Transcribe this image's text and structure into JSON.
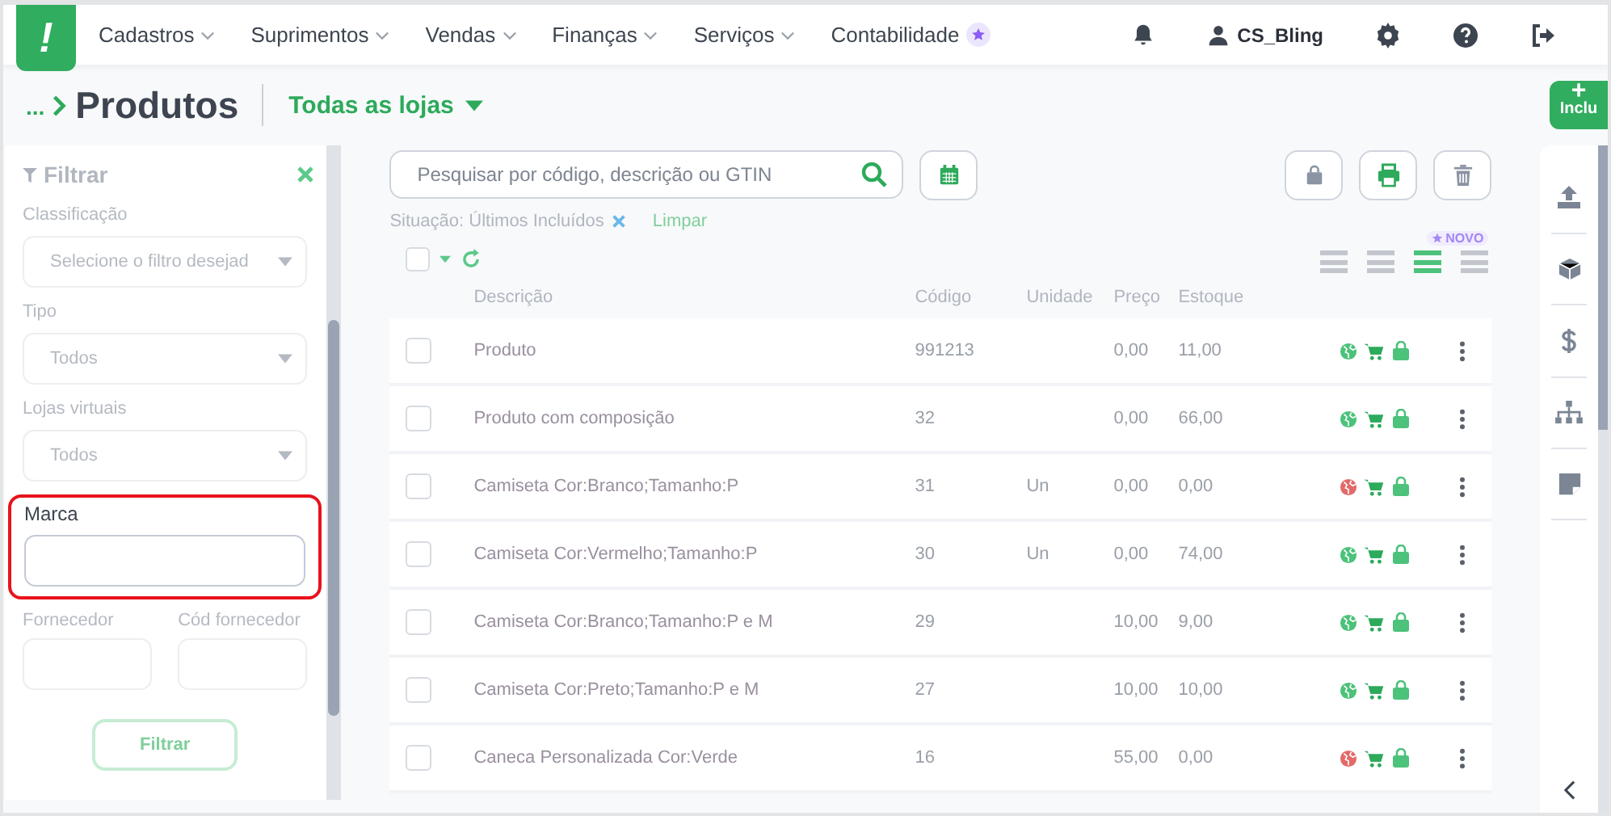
{
  "logo": "!",
  "menu": [
    {
      "label": "Cadastros",
      "kind": "dropdown"
    },
    {
      "label": "Suprimentos",
      "kind": "dropdown"
    },
    {
      "label": "Vendas",
      "kind": "dropdown"
    },
    {
      "label": "Finanças",
      "kind": "dropdown"
    },
    {
      "label": "Serviços",
      "kind": "dropdown"
    },
    {
      "label": "Contabilidade",
      "kind": "starred"
    }
  ],
  "user": "CS_Bling",
  "breadcrumb": {
    "ellipsis": "...",
    "title": "Produtos",
    "store": "Todas as lojas"
  },
  "add_button": {
    "icon": "+",
    "label": "Inclu"
  },
  "filter": {
    "title": "Filtrar",
    "fields": [
      {
        "label": "Classificação",
        "kind": "select",
        "value": "Selecione o filtro desejad",
        "highlighted": false
      },
      {
        "label": "Tipo",
        "kind": "select",
        "value": "Todos",
        "highlighted": false
      },
      {
        "label": "Lojas virtuais",
        "kind": "select",
        "value": "Todos",
        "highlighted": false
      },
      {
        "label": "Marca",
        "kind": "input",
        "highlighted": true
      }
    ],
    "pair": [
      {
        "label": "Fornecedor"
      },
      {
        "label": "Cód fornecedor"
      }
    ],
    "button": "Filtrar"
  },
  "search": {
    "placeholder": "Pesquisar por código, descrição ou GTIN"
  },
  "active_filter": {
    "label": "Situação: Últimos Incluídos",
    "clear": "Limpar"
  },
  "new_badge": "NOVO",
  "select_all": {
    "checked": false
  },
  "view_modes": [
    {
      "selected": false
    },
    {
      "selected": false
    },
    {
      "selected": true
    },
    {
      "selected": false
    }
  ],
  "columns": [
    "Descrição",
    "Código",
    "Unidade",
    "Preço",
    "Estoque"
  ],
  "rows": [
    {
      "description": "Produto",
      "code": "991213",
      "unit": "",
      "price": "0,00",
      "stock": "11,00",
      "published": true,
      "checked": false
    },
    {
      "description": "Produto com composição",
      "code": "32",
      "unit": "",
      "price": "0,00",
      "stock": "66,00",
      "published": true,
      "checked": false
    },
    {
      "description": "Camiseta Cor:Branco;Tamanho:P",
      "code": "31",
      "unit": "Un",
      "price": "0,00",
      "stock": "0,00",
      "published": false,
      "checked": false
    },
    {
      "description": "Camiseta Cor:Vermelho;Tamanho:P",
      "code": "30",
      "unit": "Un",
      "price": "0,00",
      "stock": "74,00",
      "published": true,
      "checked": false
    },
    {
      "description": "Camiseta Cor:Branco;Tamanho:P e M",
      "code": "29",
      "unit": "",
      "price": "10,00",
      "stock": "9,00",
      "published": true,
      "checked": false
    },
    {
      "description": "Camiseta Cor:Preto;Tamanho:P e M",
      "code": "27",
      "unit": "",
      "price": "10,00",
      "stock": "10,00",
      "published": true,
      "checked": false
    },
    {
      "description": "Caneca Personalizada Cor:Verde",
      "code": "16",
      "unit": "",
      "price": "55,00",
      "stock": "0,00",
      "published": false,
      "checked": false
    }
  ]
}
